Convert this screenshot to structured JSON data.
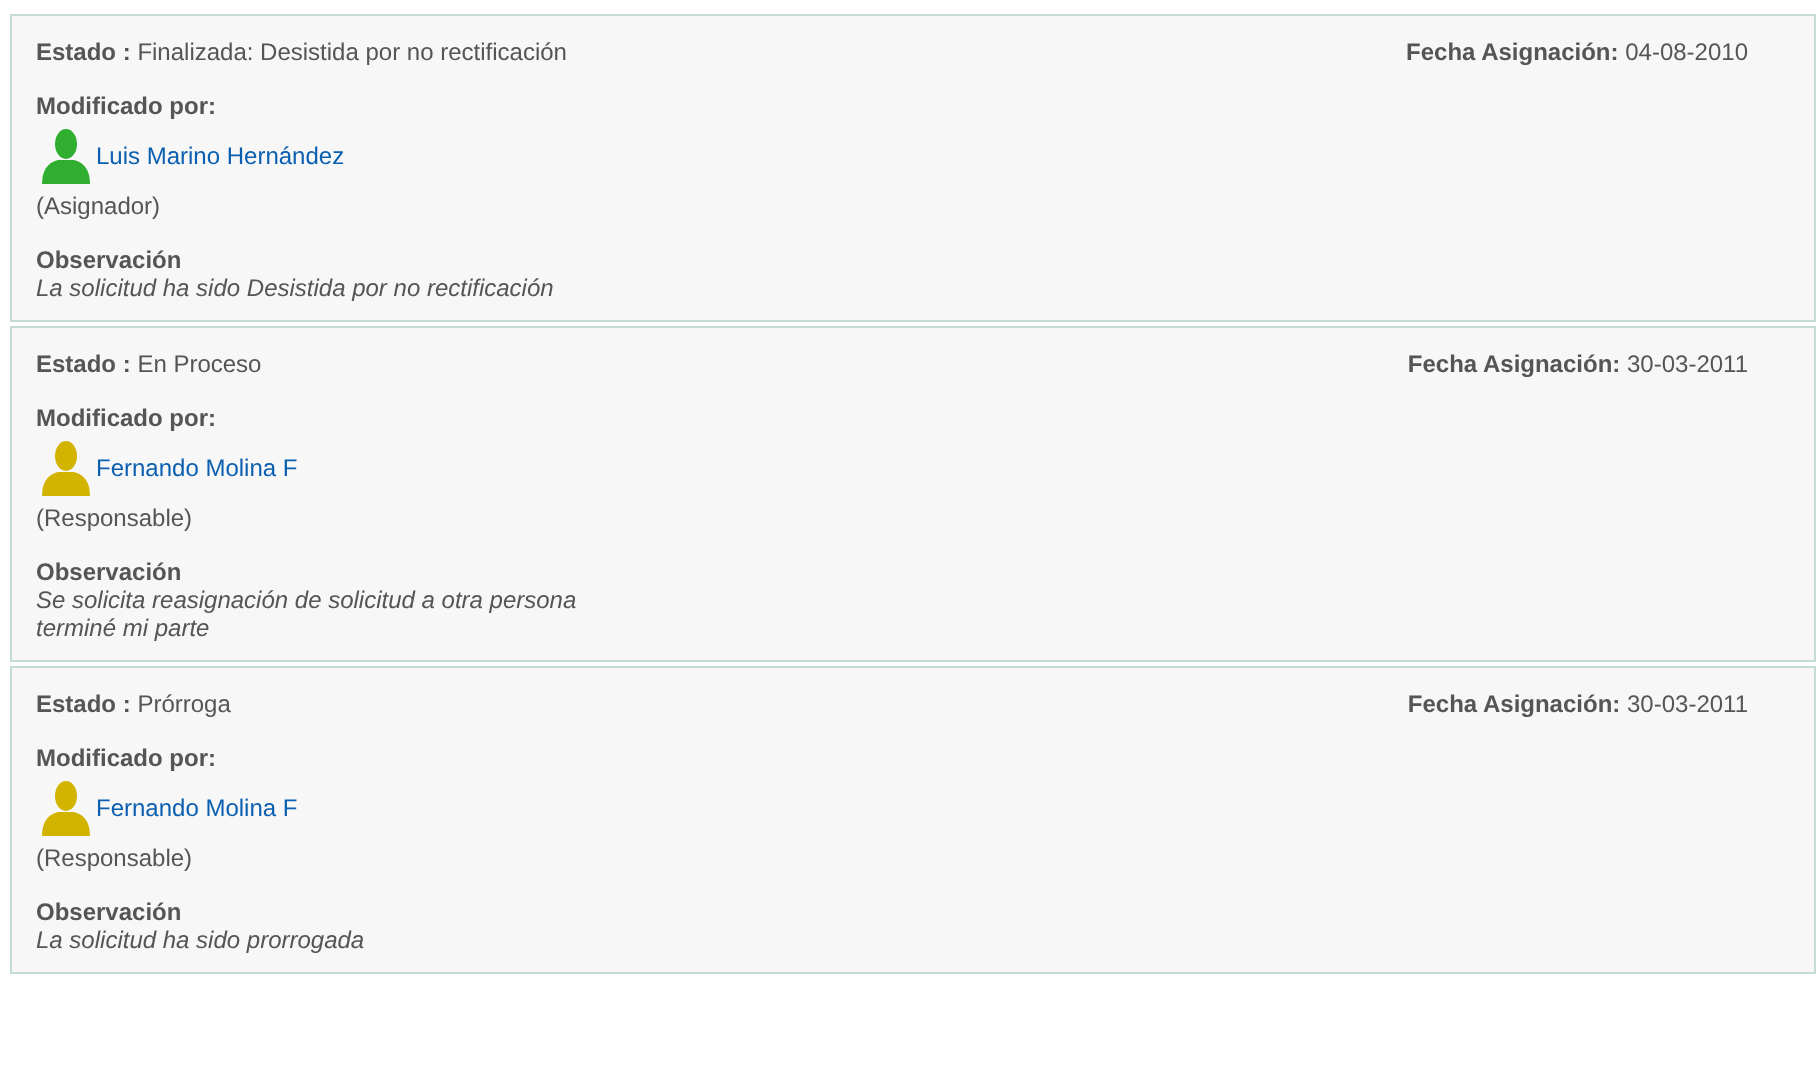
{
  "entries": [
    {
      "estado_label": "Estado :",
      "estado": "Finalizada: Desistida por no rectificación",
      "fecha_label": "Fecha Asignación:",
      "fecha": "04-08-2010",
      "modified_label": "Modificado por:",
      "user": {
        "name": "Luis Marino Hernández",
        "color": "#2fae2f"
      },
      "role": "(Asignador)",
      "observation_label": "Observación",
      "observation_lines": [
        "La solicitud ha sido Desistida por no rectificación"
      ]
    },
    {
      "estado_label": "Estado :",
      "estado": "En Proceso",
      "fecha_label": "Fecha Asignación:",
      "fecha": "30-03-2011",
      "modified_label": "Modificado por:",
      "user": {
        "name": "Fernando Molina F",
        "color": "#d2b400"
      },
      "role": "(Responsable)",
      "observation_label": "Observación",
      "observation_lines": [
        "Se solicita reasignación de solicitud a otra persona",
        "terminé mi parte"
      ]
    },
    {
      "estado_label": "Estado :",
      "estado": "Prórroga",
      "fecha_label": "Fecha Asignación:",
      "fecha": "30-03-2011",
      "modified_label": "Modificado por:",
      "user": {
        "name": "Fernando Molina F",
        "color": "#d2b400"
      },
      "role": "(Responsable)",
      "observation_label": "Observación",
      "observation_lines": [
        "La solicitud ha sido prorrogada"
      ]
    }
  ]
}
